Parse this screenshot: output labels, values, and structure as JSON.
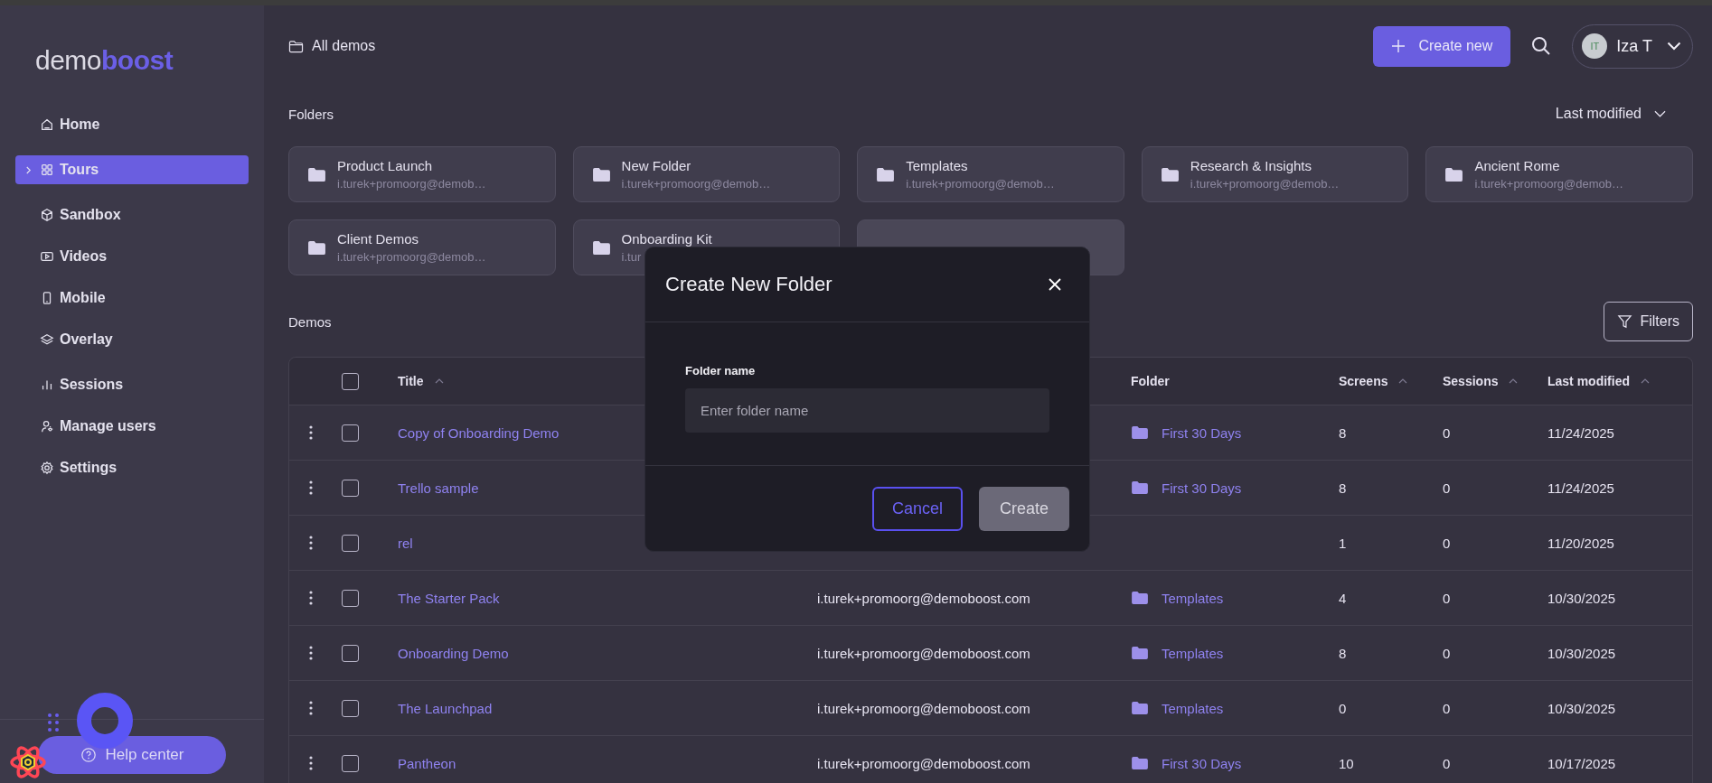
{
  "sidebar": {
    "logo": {
      "first": "demo",
      "second": "boost"
    },
    "nav_groups": [
      [
        {
          "label": "Home",
          "selected": false,
          "expandable": false
        }
      ],
      [
        {
          "label": "Tours",
          "selected": true,
          "expandable": true
        }
      ],
      [
        {
          "label": "Sandbox",
          "selected": false,
          "expandable": false
        },
        {
          "label": "Videos",
          "selected": false,
          "expandable": false
        },
        {
          "label": "Mobile",
          "selected": false,
          "expandable": false
        },
        {
          "label": "Overlay",
          "selected": false,
          "expandable": false
        }
      ],
      [
        {
          "label": "Sessions",
          "selected": false,
          "expandable": false
        },
        {
          "label": "Manage users",
          "selected": false,
          "expandable": false
        },
        {
          "label": "Settings",
          "selected": false,
          "expandable": false
        }
      ]
    ],
    "help_button": "Help center"
  },
  "breadcrumb": "All demos",
  "create_button": "Create new",
  "user": {
    "initials": "IT",
    "name": "Iza T"
  },
  "folders": {
    "heading": "Folders",
    "sort": "Last modified",
    "items": [
      {
        "kind": "folder",
        "name": "Product Launch",
        "owner": "i.turek+promoorg@demob…"
      },
      {
        "kind": "folder",
        "name": "New Folder",
        "owner": "i.turek+promoorg@demob…"
      },
      {
        "kind": "folder",
        "name": "Templates",
        "owner": "i.turek+promoorg@demob…"
      },
      {
        "kind": "folder",
        "name": "Research & Insights",
        "owner": "i.turek+promoorg@demob…"
      },
      {
        "kind": "folder",
        "name": "Ancient Rome",
        "owner": "i.turek+promoorg@demob…"
      },
      {
        "kind": "folder",
        "name": "Client Demos",
        "owner": "i.turek+promoorg@demob…"
      },
      {
        "kind": "folder",
        "name": "Onboarding Kit",
        "owner": "i.tur"
      },
      {
        "kind": "blank"
      }
    ]
  },
  "demos": {
    "heading": "Demos",
    "filters_button": "Filters",
    "select_all_checked": false,
    "columns": [
      {
        "label": "Title",
        "sortable": true
      },
      {
        "label": "Folder",
        "sortable": false
      },
      {
        "label": "Screens",
        "sortable": true
      },
      {
        "label": "Sessions",
        "sortable": true
      },
      {
        "label": "Last modified",
        "sortable": true
      }
    ],
    "rows": [
      {
        "checked": false,
        "title": "Copy of Onboarding Demo",
        "folder": "First 30 Days",
        "screens": "8",
        "sessions": "0",
        "modified": "11/24/2025"
      },
      {
        "checked": false,
        "title": "Trello sample",
        "folder": "First 30 Days",
        "screens": "8",
        "sessions": "0",
        "modified": "11/24/2025"
      },
      {
        "checked": false,
        "title": "rel",
        "screens": "1",
        "sessions": "0",
        "modified": "11/20/2025"
      },
      {
        "checked": false,
        "title": "The Starter Pack",
        "creator": "i.turek+promoorg@demoboost.com",
        "folder": "Templates",
        "screens": "4",
        "sessions": "0",
        "modified": "10/30/2025"
      },
      {
        "checked": false,
        "title": "Onboarding Demo",
        "creator": "i.turek+promoorg@demoboost.com",
        "folder": "Templates",
        "screens": "8",
        "sessions": "0",
        "modified": "10/30/2025"
      },
      {
        "checked": false,
        "title": "The Launchpad",
        "creator": "i.turek+promoorg@demoboost.com",
        "folder": "Templates",
        "screens": "0",
        "sessions": "0",
        "modified": "10/30/2025"
      },
      {
        "checked": false,
        "title": "Pantheon",
        "creator": "i.turek+promoorg@demoboost.com",
        "folder": "First 30 Days",
        "screens": "10",
        "sessions": "0",
        "modified": "10/17/2025"
      }
    ]
  },
  "modal": {
    "title": "Create New Folder",
    "field_label": "Folder name",
    "placeholder": "Enter folder name",
    "buttons": [
      {
        "label": "Cancel",
        "kind": "secondary",
        "disabled": false
      },
      {
        "label": "Create",
        "kind": "primary",
        "disabled": true
      }
    ]
  }
}
